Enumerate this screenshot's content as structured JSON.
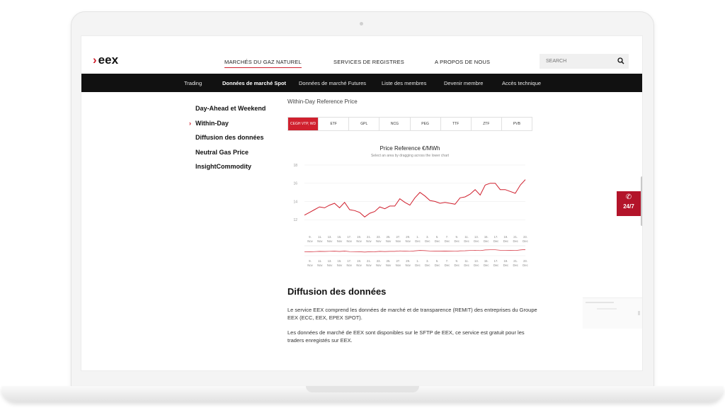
{
  "header": {
    "logo_text": "eex",
    "nav": [
      "MARCHÉS DU GAZ NATUREL",
      "SERVICES DE REGISTRES",
      "A PROPOS DE NOUS"
    ],
    "search_placeholder": "SEARCH"
  },
  "subnav": [
    "Trading",
    "Données de marché Spot",
    "Données de marché Futures",
    "Liste des membres",
    "Devenir membre",
    "Accès technique"
  ],
  "sidebar": [
    "Day-Ahead et Weekend",
    "Within-Day",
    "Diffusion des données",
    "Neutral Gas Price",
    "InsightCommodity"
  ],
  "main": {
    "section_label": "Within-Day Reference Price",
    "tabs": [
      "CEGH VTP, WD",
      "ETF",
      "GPL",
      "NCG",
      "PEG",
      "TTF",
      "ZTF",
      "PVB"
    ],
    "diffusion_heading": "Diffusion des données",
    "para1": "Le service EEX comprend les données de marché et de transparence (REMIT) des entreprises du Groupe EEX (ECC, EEX, EPEX SPOT).",
    "para2": "Les données de marché de EEX sont disponibles sur le SFTP de EEX, ce service est gratuit pour les traders enregistés sur EEX."
  },
  "phone_widget": {
    "icon": "phone-icon",
    "label": "24/7"
  },
  "colors": {
    "accent": "#d0202e",
    "nav_bg": "#111111",
    "widget": "#b3142a"
  },
  "chart_data": {
    "type": "line",
    "title": "Price Reference €/MWh",
    "subtitle": "Select an area by dragging across the lower chart",
    "ylim": [
      11,
      18
    ],
    "yticks": [
      12,
      14,
      16,
      18
    ],
    "ticks": [
      [
        "9.",
        "Nov"
      ],
      [
        "11.",
        "Nov"
      ],
      [
        "13.",
        "Nov"
      ],
      [
        "15.",
        "Nov"
      ],
      [
        "17.",
        "Nov"
      ],
      [
        "19.",
        "Nov"
      ],
      [
        "21.",
        "Nov"
      ],
      [
        "23.",
        "Nov"
      ],
      [
        "25.",
        "Nov"
      ],
      [
        "27.",
        "Nov"
      ],
      [
        "29.",
        "Nov"
      ],
      [
        "1.",
        "Dec"
      ],
      [
        "3.",
        "Dec"
      ],
      [
        "5.",
        "Dec"
      ],
      [
        "7.",
        "Dec"
      ],
      [
        "9.",
        "Dec"
      ],
      [
        "11.",
        "Dec"
      ],
      [
        "13.",
        "Dec"
      ],
      [
        "15.",
        "Dec"
      ],
      [
        "17.",
        "Dec"
      ],
      [
        "19.",
        "Dec"
      ],
      [
        "21.",
        "Dec"
      ],
      [
        "23.",
        "Dec"
      ]
    ],
    "x": [
      "9 Nov",
      "10 Nov",
      "11 Nov",
      "12 Nov",
      "13 Nov",
      "14 Nov",
      "15 Nov",
      "16 Nov",
      "17 Nov",
      "18 Nov",
      "19 Nov",
      "20 Nov",
      "21 Nov",
      "22 Nov",
      "23 Nov",
      "24 Nov",
      "25 Nov",
      "26 Nov",
      "27 Nov",
      "28 Nov",
      "29 Nov",
      "30 Nov",
      "1 Dec",
      "2 Dec",
      "3 Dec",
      "4 Dec",
      "5 Dec",
      "6 Dec",
      "7 Dec",
      "8 Dec",
      "9 Dec",
      "10 Dec",
      "11 Dec",
      "12 Dec",
      "13 Dec",
      "14 Dec",
      "15 Dec",
      "16 Dec",
      "17 Dec",
      "18 Dec",
      "19 Dec",
      "20 Dec",
      "21 Dec",
      "22 Dec",
      "23 Dec"
    ],
    "values": [
      12.5,
      12.8,
      13.1,
      13.4,
      13.3,
      13.6,
      13.8,
      13.3,
      13.9,
      13.1,
      13.0,
      12.8,
      12.3,
      12.7,
      12.9,
      13.4,
      13.2,
      13.5,
      13.5,
      14.3,
      13.9,
      13.6,
      14.4,
      15.0,
      14.6,
      14.1,
      14.0,
      13.8,
      13.9,
      13.8,
      13.7,
      14.4,
      14.5,
      14.8,
      15.3,
      14.7,
      15.8,
      16.0,
      16.0,
      15.3,
      15.3,
      15.1,
      14.9,
      15.8,
      16.4
    ]
  }
}
